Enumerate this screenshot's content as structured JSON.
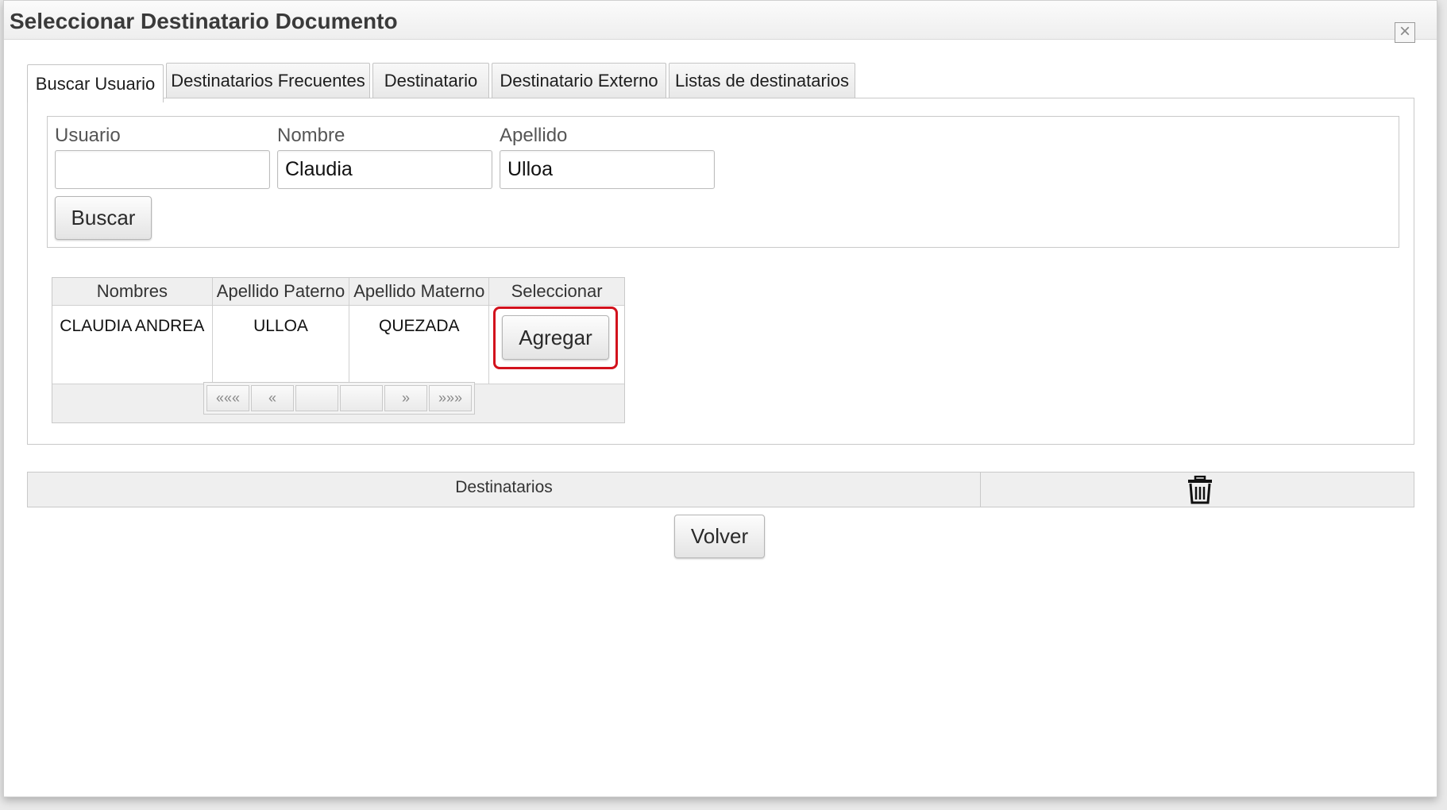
{
  "dialog": {
    "title": "Seleccionar Destinatario Documento",
    "close_icon": "close-icon"
  },
  "tabs": [
    {
      "label": "Buscar Usuario",
      "active": true
    },
    {
      "label": "Destinatarios Frecuentes",
      "active": false
    },
    {
      "label": "Destinatario",
      "active": false
    },
    {
      "label": "Destinatario Externo",
      "active": false
    },
    {
      "label": "Listas de destinatarios",
      "active": false
    }
  ],
  "search": {
    "usuario_label": "Usuario",
    "usuario_value": "",
    "nombre_label": "Nombre",
    "nombre_value": "Claudia",
    "apellido_label": "Apellido",
    "apellido_value": "Ulloa",
    "buscar_label": "Buscar"
  },
  "results": {
    "columns": [
      "Nombres",
      "Apellido Paterno",
      "Apellido Materno",
      "Seleccionar"
    ],
    "rows": [
      {
        "nombres": "CLAUDIA ANDREA",
        "paterno": "ULLOA",
        "materno": "QUEZADA",
        "action_label": "Agregar"
      }
    ],
    "pager": {
      "first": "«««",
      "prev": "«",
      "next": "»",
      "last": "»»»"
    },
    "highlight_color": "#d2121d"
  },
  "destinatarios": {
    "header": "Destinatarios",
    "delete_icon": "trash-icon"
  },
  "footer": {
    "volver_label": "Volver"
  }
}
